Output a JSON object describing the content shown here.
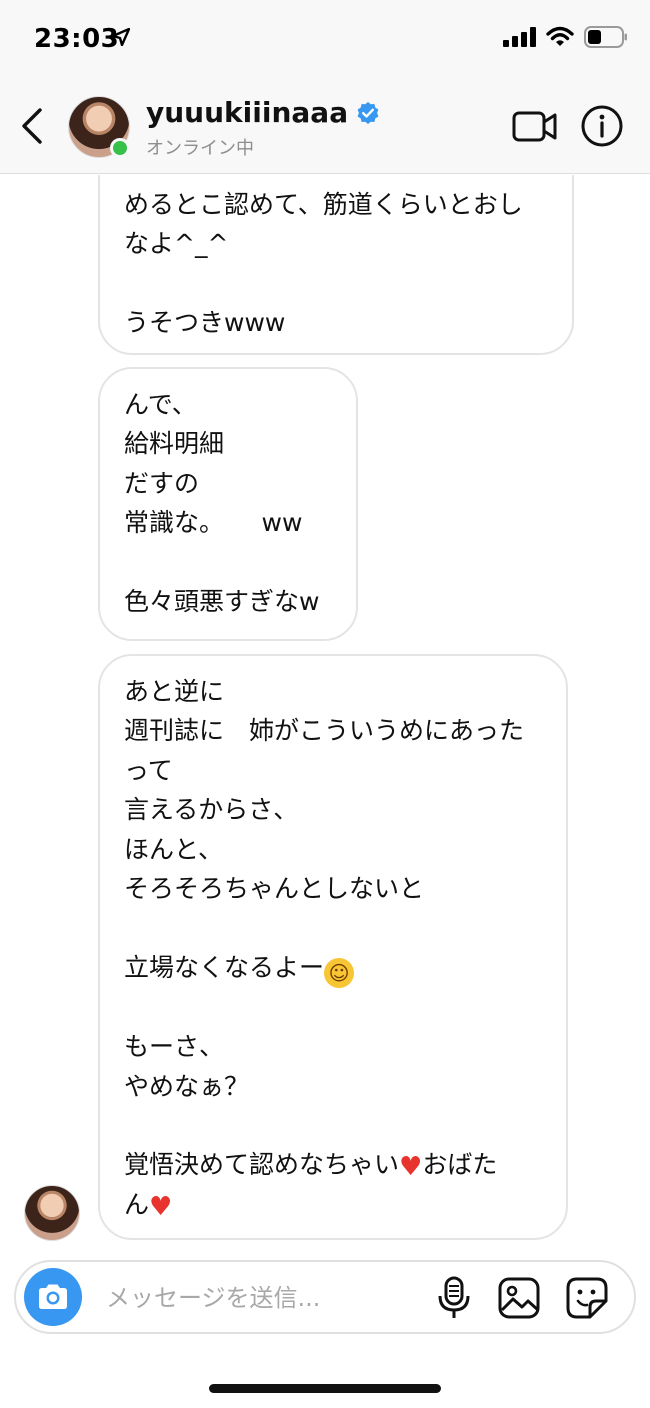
{
  "status_bar": {
    "time": "23:03"
  },
  "header": {
    "username": "yuuukiiinaaa",
    "presence": "オンライン中",
    "verified": true
  },
  "messages": [
    {
      "lines": [
        "めるとこ認めて、筋道くらいとおし",
        "なよ^_^",
        "",
        "うそつきwww"
      ]
    },
    {
      "lines": [
        "んで、",
        "給料明細",
        "だすの",
        "常識な。　　ww",
        "",
        "色々頭悪すぎなw"
      ]
    },
    {
      "lines": [
        "あと逆に",
        "週刊誌に　姉がこういうめにあった",
        "って",
        "言えるからさ、",
        "ほんと、",
        "そろそろちゃんとしないと",
        "",
        "立場なくなるよー",
        "",
        "もーさ、",
        "やめなぁ？",
        "",
        "覚悟決めて認めなちゃい",
        "おばた",
        "ん"
      ]
    }
  ],
  "composer": {
    "placeholder": "メッセージを送信..."
  },
  "colors": {
    "accent": "#3897f0",
    "online": "#38c14a",
    "verified": "#3897f0",
    "heart": "#e8342e"
  },
  "icons": [
    "back-chevron-icon",
    "verified-badge-icon",
    "video-call-icon",
    "info-icon",
    "camera-icon",
    "microphone-icon",
    "gallery-icon",
    "sticker-icon",
    "location-arrow-icon",
    "signal-icon",
    "wifi-icon",
    "battery-icon"
  ]
}
